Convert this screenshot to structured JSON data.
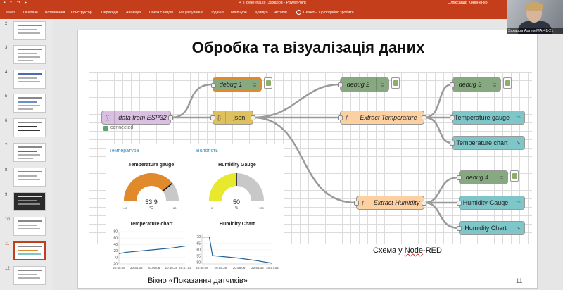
{
  "app": {
    "doc_title": "4_Презентація_Захаров  -  PowerPoint",
    "user": "Олександр Кононенко"
  },
  "ribbon_tabs": [
    "Файл",
    "Основне",
    "Вставлення",
    "Конструктор",
    "Переходи",
    "Анімація",
    "Показ слайдів",
    "Рецензування",
    "Подання",
    "MathType",
    "Довідка",
    "Acrobat"
  ],
  "tell_me": "Скажіть, що потрібно зробити",
  "thumbnails": [
    {
      "num": "2"
    },
    {
      "num": "3"
    },
    {
      "num": "4"
    },
    {
      "num": "5"
    },
    {
      "num": "6"
    },
    {
      "num": "7"
    },
    {
      "num": "8"
    },
    {
      "num": "9"
    },
    {
      "num": "10"
    },
    {
      "num": "11"
    },
    {
      "num": "12"
    }
  ],
  "slide": {
    "title": "Обробка та візуалізація даних",
    "number": "11",
    "caption_dashboard": "Вікно «Показання датчиків»",
    "caption_node_prefix": "Схема у ",
    "caption_node_word": "Node",
    "caption_node_suffix": "-RED"
  },
  "flow": {
    "nodes": {
      "data_from_esp32": "data from ESP32",
      "status_connected": "connected",
      "json": "json",
      "debug1": "debug 1",
      "debug2": "debug 2",
      "debug3": "debug 3",
      "debug4": "debug 4",
      "extract_temperature": "Extract Temperature",
      "extract_humidity": "Extract Humidity",
      "temperature_gauge": "Temperature gauge",
      "temperature_chart": "Temperature chart",
      "humidity_gauge": "Humidity Gauge",
      "humidity_chart": "Humidity Chart"
    },
    "colors": {
      "debug": "#87a980",
      "json": "#dec05d",
      "input": "#d9bfe0",
      "function": "#fdd0a2",
      "dashboard": "#7fc6c8"
    }
  },
  "dashboard": {
    "group_temperature": "Температура",
    "group_humidity": "Вологість",
    "temperature_gauge": {
      "title": "Temperature gauge",
      "value": "53.9",
      "unit": "°C",
      "min": "-40",
      "max": "80",
      "fraction": 0.78,
      "color": "#e08a2c"
    },
    "humidity_gauge": {
      "title": "Humidity Gauge",
      "value": "50",
      "unit": "%",
      "min": "0",
      "max": "100",
      "fraction": 0.5,
      "color": "#e8e82c"
    },
    "temperature_chart": {
      "title": "Temperature chart"
    },
    "humidity_chart": {
      "title": "Humidity Chart"
    }
  },
  "chart_data": [
    {
      "type": "line",
      "title": "Temperature chart",
      "yticks": [
        "80",
        "60",
        "40",
        "20",
        "0",
        "-20"
      ],
      "xticks": [
        "20:55:08",
        "20:55:38",
        "20:56:08",
        "20:56:38",
        "20:57:02"
      ],
      "ylim": [
        -20,
        80
      ],
      "series": [
        {
          "x": [
            "20:55:08",
            "20:55:20",
            "20:55:38",
            "20:56:08",
            "20:56:38",
            "20:57:02"
          ],
          "values": [
            12,
            16,
            19,
            24,
            29,
            35
          ]
        }
      ]
    },
    {
      "type": "line",
      "title": "Humidity Chart",
      "yticks": [
        "70",
        "65",
        "60",
        "55",
        "50"
      ],
      "xticks": [
        "20:55:08",
        "20:55:38",
        "20:56:08",
        "20:56:38",
        "20:57:02"
      ],
      "ylim": [
        49,
        72
      ],
      "series": [
        {
          "x": [
            "20:55:08",
            "20:55:20",
            "20:55:25",
            "20:56:08",
            "20:56:38",
            "20:57:02"
          ],
          "values": [
            70,
            70,
            55.5,
            53.5,
            51.5,
            49.5
          ]
        }
      ]
    }
  ],
  "webcam": {
    "name": "Захаров Артем МА-41-21"
  }
}
